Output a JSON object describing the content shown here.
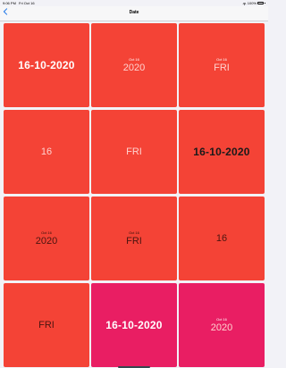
{
  "status_bar": {
    "time": "9:06 PM",
    "date": "Fri Oct 16",
    "battery": "100%"
  },
  "nav": {
    "title": "Date"
  },
  "tiles": [
    {
      "date_full": "16-10-2020"
    },
    {
      "small": "Oct 16",
      "large": "2020"
    },
    {
      "small": "Oct 16",
      "large": "FRI"
    },
    {
      "large": "16"
    },
    {
      "large": "FRI"
    },
    {
      "date_full": "16-10-2020"
    },
    {
      "small": "Oct 16",
      "large": "2020"
    },
    {
      "small": "Oct 16",
      "large": "FRI"
    },
    {
      "large": "16"
    },
    {
      "large": "FRI"
    },
    {
      "date_full": "16-10-2020"
    },
    {
      "small": "Oct 16",
      "large": "2020"
    }
  ],
  "colors": {
    "tile_red": "#f44336",
    "tile_pink": "#e91e63",
    "accent_blue": "#1a73e8"
  }
}
